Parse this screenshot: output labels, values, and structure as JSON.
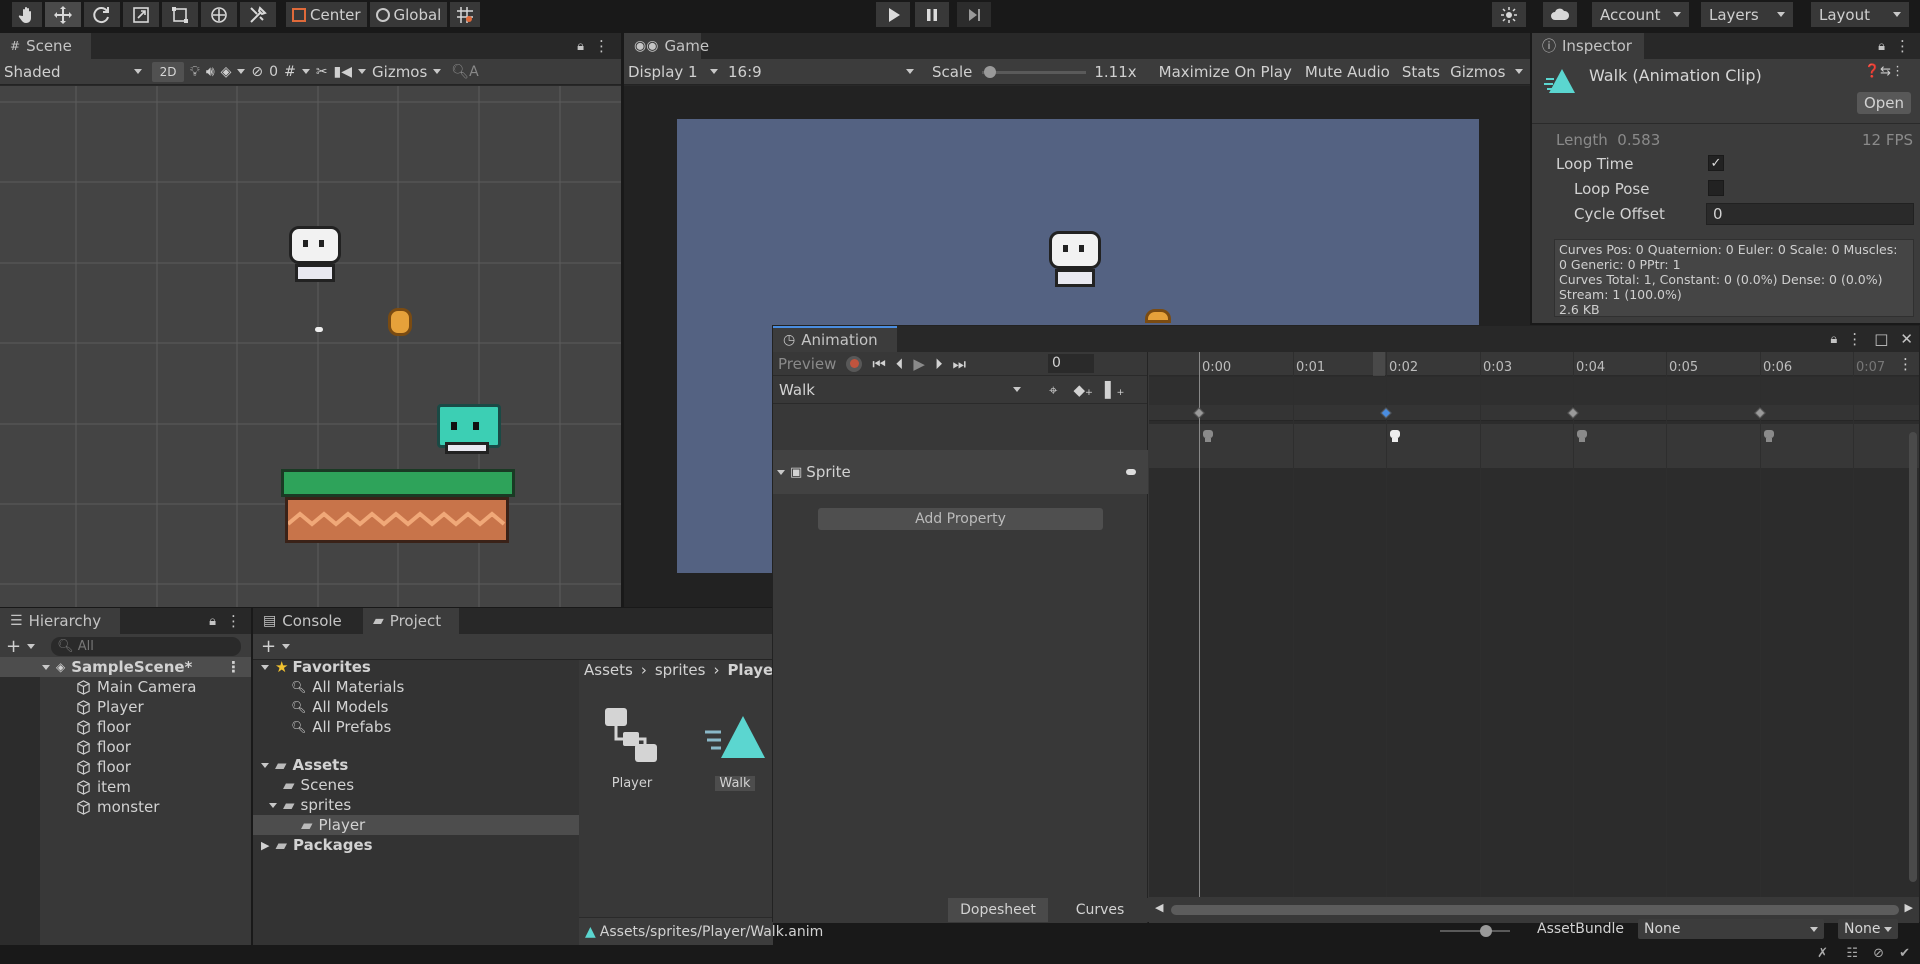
{
  "toolbar": {
    "center": "Center",
    "global": "Global",
    "account": "Account",
    "layers": "Layers",
    "layout": "Layout"
  },
  "scene": {
    "tab": "Scene",
    "shading": "Shaded",
    "mode2d": "2D",
    "hidden_count": "0",
    "gizmos": "Gizmos"
  },
  "game": {
    "tab": "Game",
    "display": "Display 1",
    "aspect": "16:9",
    "scale_label": "Scale",
    "scale_value": "1.11x",
    "maximize": "Maximize On Play",
    "mute": "Mute Audio",
    "stats": "Stats",
    "gizmos": "Gizmos"
  },
  "inspector": {
    "tab": "Inspector",
    "title": "Walk (Animation Clip)",
    "open": "Open",
    "length_label": "Length",
    "length_value": "0.583",
    "fps": "12 FPS",
    "loop_time": "Loop Time",
    "loop_pose": "Loop Pose",
    "cycle_offset": "Cycle Offset",
    "cycle_value": "0",
    "info": [
      "Curves Pos: 0 Quaternion: 0 Euler: 0 Scale: 0 Muscles: 0 Generic: 0 PPtr: 1",
      "Curves Total: 1, Constant: 0 (0.0%) Dense: 0 (0.0%)",
      "Stream: 1 (100.0%)",
      "2.6 KB"
    ],
    "assetbundle": "AssetBundle",
    "ab_value": "None",
    "ab_variant": "None"
  },
  "animation": {
    "tab": "Animation",
    "preview": "Preview",
    "frame": "0",
    "clip": "Walk",
    "property": "Sprite",
    "add_property": "Add Property",
    "dopesheet": "Dopesheet",
    "curves": "Curves",
    "times": [
      "0:00",
      "0:01",
      "0:02",
      "0:03",
      "0:04",
      "0:05",
      "0:06",
      "0:07"
    ]
  },
  "hierarchy": {
    "tab": "Hierarchy",
    "search": "All",
    "scene": "SampleScene*",
    "items": [
      "Main Camera",
      "Player",
      "floor",
      "floor",
      "floor",
      "item",
      "monster"
    ]
  },
  "project": {
    "tab_console": "Console",
    "tab_project": "Project",
    "search": "All",
    "favorites": "Favorites",
    "fav_items": [
      "All Materials",
      "All Models",
      "All Prefabs"
    ],
    "assets": "Assets",
    "scenes": "Scenes",
    "sprites": "sprites",
    "player": "Player",
    "packages": "Packages",
    "breadcrumb": [
      "Assets",
      "sprites",
      "Player"
    ],
    "files": [
      "Player",
      "Walk"
    ],
    "path": "Assets/sprites/Player/Walk.anim"
  }
}
